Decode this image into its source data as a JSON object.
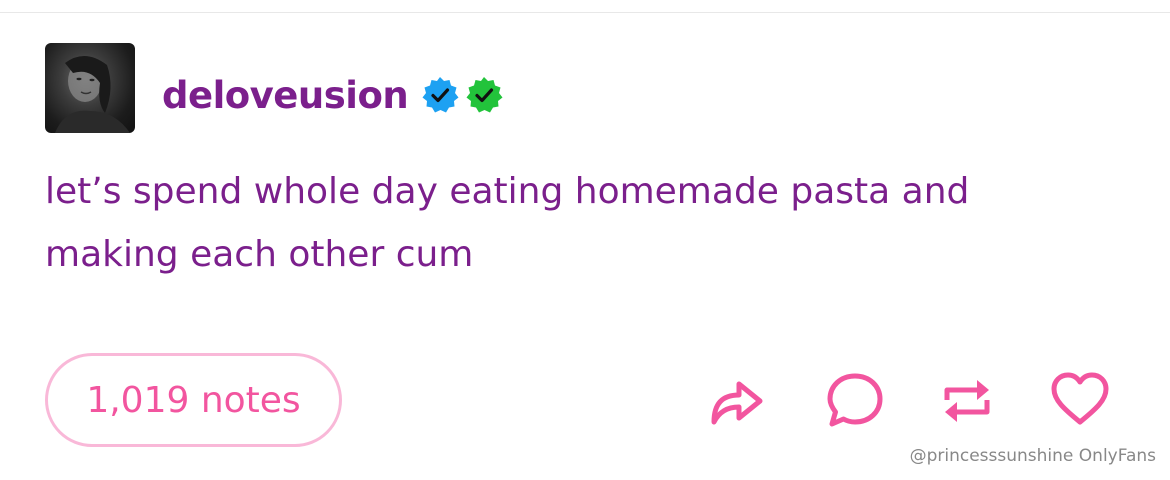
{
  "post": {
    "username": "deloveusion",
    "badges": [
      {
        "name": "verified-badge-blue",
        "color": "#1DA1F2"
      },
      {
        "name": "verified-badge-green",
        "color": "#22C33B"
      }
    ],
    "text_lines": [
      "let’s spend whole day eating homemade pasta and",
      "making each other cum"
    ],
    "notes_label": "1,019 notes"
  },
  "actions": {
    "share_icon": "share-icon",
    "reply_icon": "reply-icon",
    "reblog_icon": "reblog-icon",
    "like_icon": "heart-icon",
    "color": "#F2559F"
  },
  "watermark": "@princesssunshine OnlyFans",
  "colors": {
    "text": "#7B1F8C",
    "accent": "#F2559F",
    "pill_border": "#F9B8D8"
  }
}
